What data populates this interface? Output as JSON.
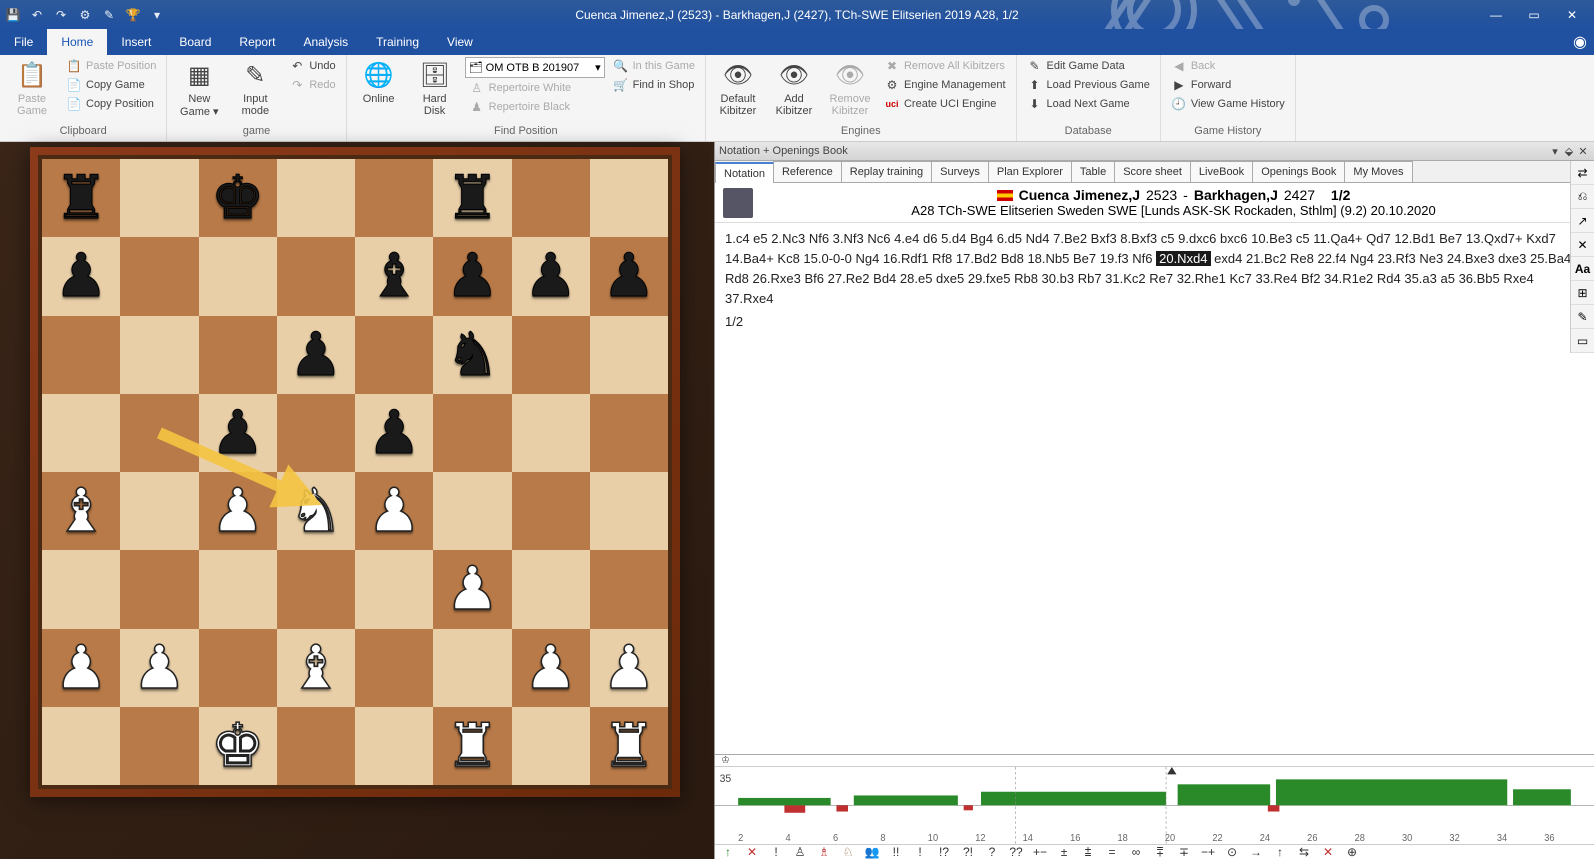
{
  "title": "Cuenca Jimenez,J (2523) - Barkhagen,J (2427), TCh-SWE Elitserien 2019  A28, 1/2",
  "menus": [
    "File",
    "Home",
    "Insert",
    "Board",
    "Report",
    "Analysis",
    "Training",
    "View"
  ],
  "active_menu": 1,
  "ribbon": {
    "clipboard": {
      "label": "Clipboard",
      "paste_game": "Paste\nGame",
      "paste_position": "Paste Position",
      "copy_game": "Copy Game",
      "copy_position": "Copy Position"
    },
    "game": {
      "label": "game",
      "new_game": "New\nGame ▾",
      "input_mode": "Input\nmode",
      "undo": "Undo",
      "redo": "Redo"
    },
    "find_position": {
      "label": "Find Position",
      "online": "Online",
      "hard_disk": "Hard\nDisk",
      "combo_value": "OM OTB B 201907",
      "in_this_game": "In this Game",
      "find_in_shop": "Find in Shop",
      "repertoire_white": "Repertoire White",
      "repertoire_black": "Repertoire Black"
    },
    "engines": {
      "label": "Engines",
      "default_kibitzer": "Default\nKibitzer",
      "add_kibitzer": "Add\nKibitzer",
      "remove_kibitzer": "Remove\nKibitzer",
      "remove_all": "Remove All Kibitzers",
      "engine_mgmt": "Engine Management",
      "create_uci": "Create UCI Engine"
    },
    "database": {
      "label": "Database",
      "edit_game": "Edit Game Data",
      "load_prev": "Load Previous Game",
      "load_next": "Load Next Game"
    },
    "history": {
      "label": "Game History",
      "back": "Back",
      "forward": "Forward",
      "view_history": "View Game History"
    }
  },
  "pane_title": "Notation + Openings Book",
  "notation_tabs": [
    "Notation",
    "Reference",
    "Replay training",
    "Surveys",
    "Plan Explorer",
    "Table",
    "Score sheet",
    "LiveBook",
    "Openings Book",
    "My Moves"
  ],
  "active_tab": 0,
  "game_header": {
    "white": "Cuenca Jimenez,J",
    "white_elo": "2523",
    "black": "Barkhagen,J",
    "black_elo": "2427",
    "result": "1/2",
    "eco": "A28",
    "event": "TCh-SWE Elitserien Sweden SWE [Lunds ASK-SK Rockaden, Sthlm] (9.2) 20.10.2020"
  },
  "moves_pre": "1.c4  e5  2.Nc3  Nf6  3.Nf3  Nc6  4.e4  d6  5.d4  Bg4  6.d5  Nd4  7.Be2  Bxf3  8.Bxf3  c5  9.dxc6  bxc6  10.Be3  c5  11.Qa4+  Qd7  12.Bd1  Be7  13.Qxd7+  Kxd7  14.Ba4+  Kc8  15.0-0-0  Ng4  16.Rdf1  Rf8  17.Bd2  Bd8  18.Nb5  Be7  19.f3  Nf6  ",
  "highlight_move": "20.Nxd4",
  "moves_post": "  exd4  21.Bc2  Re8  22.f4  Ng4  23.Rf3  Ne3  24.Bxe3  dxe3  25.Ba4  Rd8  26.Rxe3  Bf6  27.Re2  Bd4  28.e5  dxe5  29.fxe5  Rb8  30.b3  Rb7  31.Kc2  Re7  32.Rhe1  Kc7  33.Re4  Bf2  34.R1e2  Rd4  35.a3  a5  36.Bb5  Rxe4  37.Rxe4",
  "final_result": "1/2",
  "eval_value": "35",
  "eval_ticks": [
    "2",
    "4",
    "6",
    "8",
    "10",
    "12",
    "14",
    "16",
    "18",
    "20",
    "22",
    "24",
    "26",
    "28",
    "30",
    "32",
    "34",
    "36"
  ],
  "annot_symbols": [
    "↑",
    "✕",
    "!",
    "♙",
    "♗",
    "♘",
    "👥",
    "!!",
    "!",
    "!?",
    "?!",
    "?",
    "??",
    "+−",
    "±",
    "⩲",
    "=",
    "∞",
    "⩱",
    "∓",
    "−+",
    "⊙",
    "→",
    "↑",
    "⇆",
    "✕",
    "⊕"
  ],
  "board_position": {
    "a8": "br",
    "c8": "bk",
    "f8": "br",
    "a7": "bp",
    "e7": "bb",
    "f7": "bp",
    "g7": "bp",
    "h7": "bp",
    "d6": "bp",
    "f6": "bn",
    "c5": "bp",
    "e5": "bp",
    "a4": "wb",
    "c4": "wp",
    "d4": "wn",
    "e4": "wp",
    "f3": "wp",
    "a2": "wp",
    "b2": "wp",
    "d2": "wb",
    "g2": "wp",
    "h2": "wp",
    "c1": "wk",
    "f1": "wr",
    "h1": "wr"
  }
}
